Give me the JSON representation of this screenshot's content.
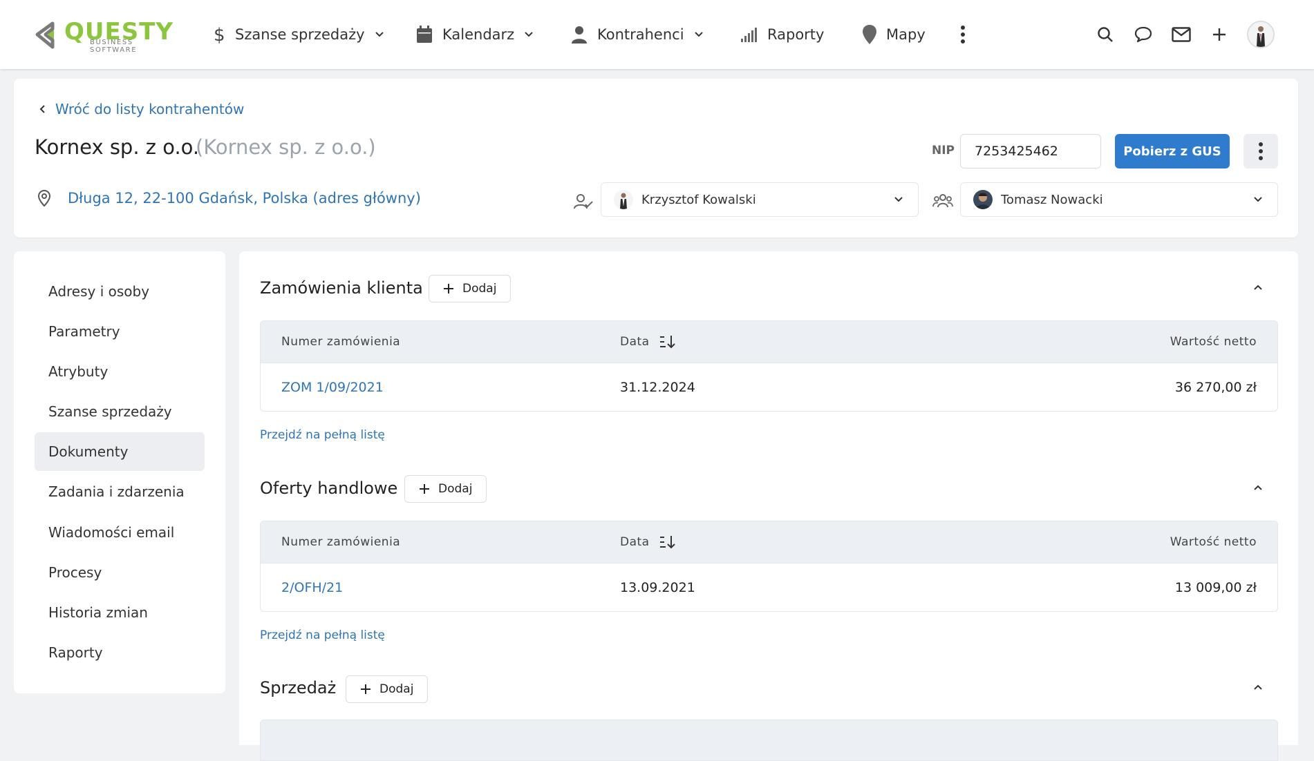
{
  "nav": {
    "logo_text": "QUESTY",
    "logo_sub": "BUSINESS SOFTWARE",
    "items": [
      {
        "label": "Szanse sprzedaży",
        "icon": "dollar-icon"
      },
      {
        "label": "Kalendarz",
        "icon": "calendar-icon"
      },
      {
        "label": "Kontrahenci",
        "icon": "person-icon"
      },
      {
        "label": "Raporty",
        "icon": "bar-signal-icon"
      },
      {
        "label": "Mapy",
        "icon": "map-pin-icon"
      }
    ],
    "right_icons": [
      "search-icon",
      "chat-icon",
      "mail-icon",
      "plus-icon"
    ]
  },
  "header": {
    "back_label": "Wróć do listy kontrahentów",
    "company_name": "Kornex sp. z o.o.",
    "company_alias": "(Kornex sp. z o.o.)",
    "nip_label": "NIP",
    "nip_value": "7253425462",
    "gus_button": "Pobierz z GUS",
    "address": "Długa 12, 22-100 Gdańsk, Polska (adres główny)",
    "owner": "Krzysztof Kowalski",
    "team_member": "Tomasz Nowacki"
  },
  "sidebar": {
    "items": [
      {
        "label": "Adresy i osoby",
        "active": false
      },
      {
        "label": "Parametry",
        "active": false
      },
      {
        "label": "Atrybuty",
        "active": false
      },
      {
        "label": "Szanse sprzedaży",
        "active": false
      },
      {
        "label": "Dokumenty",
        "active": true
      },
      {
        "label": "Zadania i zdarzenia",
        "active": false
      },
      {
        "label": "Wiadomości email",
        "active": false
      },
      {
        "label": "Procesy",
        "active": false
      },
      {
        "label": "Historia zmian",
        "active": false
      },
      {
        "label": "Raporty",
        "active": false
      }
    ]
  },
  "sections": [
    {
      "title": "Zamówienia klienta",
      "add_label": "Dodaj",
      "columns": [
        "Numer zamówienia",
        "Data",
        "Wartość netto"
      ],
      "rows": [
        {
          "number": "ZOM 1/09/2021",
          "date": "31.12.2024",
          "value": "36 270,00 zł"
        }
      ],
      "full_list_label": "Przejdź na pełną listę"
    },
    {
      "title": "Oferty handlowe",
      "add_label": "Dodaj",
      "columns": [
        "Numer zamówienia",
        "Data",
        "Wartość netto"
      ],
      "rows": [
        {
          "number": "2/OFH/21",
          "date": "13.09.2021",
          "value": "13 009,00 zł"
        }
      ],
      "full_list_label": "Przejdź na pełną listę"
    },
    {
      "title": "Sprzedaż",
      "add_label": "Dodaj"
    }
  ],
  "colors": {
    "accent_blue": "#2f7ccf",
    "link_blue": "#2f74b5",
    "logo_green": "#8cc63f"
  }
}
